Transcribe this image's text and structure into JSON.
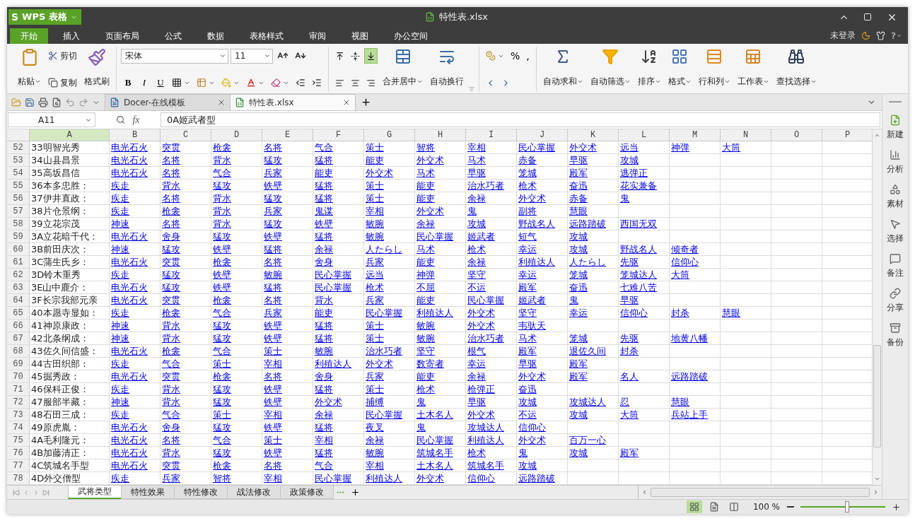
{
  "window": {
    "logo": "S",
    "app_menu": "WPS 表格",
    "title": "特性表.xlsx"
  },
  "menu_tabs": [
    {
      "label": "开始",
      "selected": true
    },
    {
      "label": "插入",
      "selected": false
    },
    {
      "label": "页面布局",
      "selected": false
    },
    {
      "label": "公式",
      "selected": false
    },
    {
      "label": "数据",
      "selected": false
    },
    {
      "label": "表格样式",
      "selected": false
    },
    {
      "label": "审阅",
      "selected": false
    },
    {
      "label": "视图",
      "selected": false
    },
    {
      "label": "办公空间",
      "selected": false
    }
  ],
  "account": {
    "login": "未登录",
    "help": "?"
  },
  "ribbon": {
    "paste": "粘贴",
    "cut": "剪切",
    "copy": "复制",
    "format_painter": "格式刷",
    "font": "宋体",
    "font_size": "11",
    "bold": "B",
    "italic": "I",
    "underline": "U",
    "vertical_align": [
      {
        "kind": "top",
        "selected": false
      },
      {
        "kind": "middle",
        "selected": false
      },
      {
        "kind": "bottom",
        "selected": true
      }
    ],
    "merge": {
      "label": "合并居中",
      "kind": "merge",
      "dropdown": true
    },
    "wrap": {
      "label": "自动换行",
      "kind": "wrap",
      "dropdown": false
    },
    "percent": "%",
    "comma": ",",
    "large_buttons": [
      {
        "label": "自动求和",
        "kind": "sum",
        "dropdown": true
      },
      {
        "label": "自动筛选",
        "kind": "filter",
        "dropdown": true
      },
      {
        "label": "排序",
        "kind": "sort",
        "dropdown": true
      },
      {
        "label": "格式",
        "kind": "format",
        "dropdown": true
      },
      {
        "label": "行和列",
        "kind": "rows",
        "dropdown": true
      },
      {
        "label": "工作表",
        "kind": "sheet",
        "dropdown": true
      },
      {
        "label": "查找选择",
        "kind": "find",
        "dropdown": true
      }
    ]
  },
  "doc_tabs": [
    {
      "label": "Docer-在线模板",
      "kind": "docer",
      "selected": false
    },
    {
      "label": "特性表.xlsx",
      "kind": "sheet",
      "selected": true
    }
  ],
  "formula_bar": {
    "cell_ref": "A11",
    "fx": "fx",
    "formula": "0A姬武者型"
  },
  "columns": [
    {
      "label": "A",
      "selected": true
    },
    {
      "label": "B",
      "selected": false
    },
    {
      "label": "C",
      "selected": false
    },
    {
      "label": "D",
      "selected": false
    },
    {
      "label": "E",
      "selected": false
    },
    {
      "label": "F",
      "selected": false
    },
    {
      "label": "G",
      "selected": false
    },
    {
      "label": "H",
      "selected": false
    },
    {
      "label": "I",
      "selected": false
    },
    {
      "label": "J",
      "selected": false
    },
    {
      "label": "K",
      "selected": false
    },
    {
      "label": "L",
      "selected": false
    },
    {
      "label": "M",
      "selected": false
    },
    {
      "label": "N",
      "selected": false
    },
    {
      "label": "O",
      "selected": false
    },
    {
      "label": "P",
      "selected": false
    }
  ],
  "rows": [
    {
      "number": "52",
      "name": "33明智光秀",
      "traits": [
        "电光石火",
        "突贯",
        "枪衾",
        "名将",
        "气合",
        "策士",
        "智将",
        "宰相",
        "民心掌握",
        "外交术",
        "远当",
        "神弹",
        "大筒"
      ]
    },
    {
      "number": "53",
      "name": "34山县昌景",
      "traits": [
        "电光石火",
        "名将",
        "背水",
        "猛攻",
        "猛将",
        "能吏",
        "外交术",
        "马术",
        "赤备",
        "早驱",
        "攻城"
      ]
    },
    {
      "number": "54",
      "name": "35高坂昌信",
      "traits": [
        "电光石火",
        "名将",
        "气合",
        "兵家",
        "能吏",
        "外交术",
        "马术",
        "早驱",
        "笼城",
        "殿军",
        "逃弹正"
      ]
    },
    {
      "number": "55",
      "name": "36本多忠胜：",
      "traits": [
        "疾走",
        "背水",
        "猛攻",
        "铁壁",
        "猛将",
        "策士",
        "能吏",
        "治水巧者",
        "枪术",
        "奋迅",
        "花实兼备"
      ]
    },
    {
      "number": "56",
      "name": "37伊井直政：",
      "traits": [
        "疾走",
        "名将",
        "背水",
        "猛攻",
        "猛将",
        "策士",
        "能吏",
        "余禄",
        "外交术",
        "赤备",
        "鬼"
      ]
    },
    {
      "number": "57",
      "name": "38片仓景纲：",
      "traits": [
        "疾走",
        "枪衾",
        "背水",
        "兵家",
        "鬼谋",
        "宰相",
        "外交术",
        "鬼",
        "副将",
        "慧眼"
      ]
    },
    {
      "number": "58",
      "name": "39立花宗茂",
      "traits": [
        "神速",
        "名将",
        "背水",
        "猛攻",
        "铁壁",
        "敏腕",
        "余禄",
        "攻城",
        "野战名人",
        "远路踏破",
        "西国无双"
      ]
    },
    {
      "number": "59",
      "name": "3A立花暗千代：",
      "traits": [
        "电光石火",
        "舍身",
        "猛攻",
        "铁壁",
        "猛将",
        "敏腕",
        "民心掌握",
        "姬武者",
        "短气",
        "攻城"
      ]
    },
    {
      "number": "60",
      "name": "3B前田庆次：",
      "traits": [
        "神速",
        "猛攻",
        "铁壁",
        "猛将",
        "余禄",
        "人たらし",
        "马术",
        "枪术",
        "幸运",
        "攻城",
        "野战名人",
        "倾奇者"
      ]
    },
    {
      "number": "61",
      "name": "3C蒲生氏乡：",
      "traits": [
        "电光石火",
        "突贯",
        "枪衾",
        "名将",
        "舍身",
        "兵家",
        "能吏",
        "余禄",
        "利殖达人",
        "人たらし",
        "先驱",
        "信仰心"
      ]
    },
    {
      "number": "62",
      "name": "3D铃木重秀",
      "traits": [
        "疾走",
        "猛攻",
        "铁壁",
        "敏腕",
        "民心掌握",
        "远当",
        "神弹",
        "坚守",
        "幸运",
        "笼城",
        "笼城达人",
        "大筒"
      ]
    },
    {
      "number": "63",
      "name": "3E山中鹿介：",
      "traits": [
        "电光石火",
        "猛攻",
        "铁壁",
        "猛将",
        "民心掌握",
        "枪术",
        "不屈",
        "不运",
        "殿军",
        "奋迅",
        "七难八苦"
      ]
    },
    {
      "number": "64",
      "name": "3F长宗我部元亲",
      "traits": [
        "电光石火",
        "突贯",
        "枪衾",
        "名将",
        "背水",
        "兵家",
        "能吏",
        "民心掌握",
        "姬武者",
        "鬼",
        "早驱"
      ]
    },
    {
      "number": "65",
      "name": "40本愿寺显如：",
      "traits": [
        "疾走",
        "枪衾",
        "气合",
        "兵家",
        "能吏",
        "民心掌握",
        "利殖达人",
        "外交术",
        "坚守",
        "幸运",
        "信仰心",
        "封杀",
        "慧眼"
      ]
    },
    {
      "number": "66",
      "name": "41神原康政：",
      "traits": [
        "神速",
        "背水",
        "猛攻",
        "铁壁",
        "猛将",
        "策士",
        "敏腕",
        "外交术",
        "韦驮天"
      ]
    },
    {
      "number": "67",
      "name": "42北条纲成：",
      "traits": [
        "神速",
        "背水",
        "猛攻",
        "铁壁",
        "猛将",
        "策士",
        "敏腕",
        "治水巧者",
        "马术",
        "笼城",
        "先驱",
        "地黄八幡"
      ]
    },
    {
      "number": "68",
      "name": "43佐久间信盛：",
      "traits": [
        "电光石火",
        "枪衾",
        "气合",
        "策士",
        "敏腕",
        "治水巧者",
        "坚守",
        "根气",
        "殿军",
        "退佐久间",
        "封杀"
      ]
    },
    {
      "number": "69",
      "name": "44古田织部：",
      "traits": [
        "疾走",
        "气合",
        "策士",
        "宰相",
        "利殖达人",
        "外交术",
        "数寄者",
        "幸运",
        "早驱",
        "殿军"
      ]
    },
    {
      "number": "70",
      "name": "45掘秀政：",
      "traits": [
        "电光石火",
        "突贯",
        "枪衾",
        "名将",
        "舍身",
        "兵家",
        "能吏",
        "余禄",
        "外交术",
        "殿军",
        "名人",
        "远路踏破"
      ]
    },
    {
      "number": "71",
      "name": "46保科正俊：",
      "traits": [
        "疾走",
        "背水",
        "猛攻",
        "铁壁",
        "猛将",
        "策士",
        "枪术",
        "枪弹正",
        "奋迅"
      ]
    },
    {
      "number": "72",
      "name": "47服部半藏：",
      "traits": [
        "神速",
        "背水",
        "猛攻",
        "铁壁",
        "外交术",
        "捕缚",
        "鬼",
        "早驱",
        "攻城",
        "攻城达人",
        "忍",
        "慧眼"
      ]
    },
    {
      "number": "73",
      "name": "48石田三成：",
      "traits": [
        "疾走",
        "气合",
        "策士",
        "宰相",
        "余禄",
        "民心掌握",
        "土木名人",
        "外交术",
        "不运",
        "攻城",
        "大筒",
        "兵站上手"
      ]
    },
    {
      "number": "74",
      "name": "49原虎胤：",
      "traits": [
        "电光石火",
        "舍身",
        "猛攻",
        "铁壁",
        "猛将",
        "夜叉",
        "鬼",
        "攻城达人",
        "信仰心"
      ]
    },
    {
      "number": "75",
      "name": "4A毛利隆元：",
      "traits": [
        "电光石火",
        "名将",
        "气合",
        "策士",
        "宰相",
        "余禄",
        "民心掌握",
        "利殖达人",
        "外交术",
        "百万一心"
      ]
    },
    {
      "number": "76",
      "name": "4B加藤清正：",
      "traits": [
        "电光石火",
        "背水",
        "猛攻",
        "铁壁",
        "猛将",
        "敏腕",
        "筑城名手",
        "枪术",
        "鬼",
        "攻城",
        "殿军"
      ]
    },
    {
      "number": "77",
      "name": "4C筑城名手型",
      "traits": [
        "电光石火",
        "突贯",
        "枪衾",
        "名将",
        "气合",
        "宰相",
        "土木名人",
        "筑城名手",
        "攻城"
      ]
    },
    {
      "number": "78",
      "name": "4D外交僧型",
      "traits": [
        "疾走",
        "兵家",
        "智将",
        "宰相",
        "民心掌握",
        "利殖达人",
        "外交术",
        "信仰心",
        "远路踏破"
      ]
    }
  ],
  "sheet_tabs": [
    {
      "label": "武将类型",
      "selected": true
    },
    {
      "label": "特性效果",
      "selected": false
    },
    {
      "label": "特性修改",
      "selected": false
    },
    {
      "label": "战法修改",
      "selected": false
    },
    {
      "label": "政策修改",
      "selected": false
    }
  ],
  "side_panel": [
    {
      "label": "新建",
      "kind": "new"
    },
    {
      "label": "分析",
      "kind": "analyze"
    },
    {
      "label": "素材",
      "kind": "assets"
    },
    {
      "label": "选择",
      "kind": "select"
    },
    {
      "label": "备注",
      "kind": "note"
    },
    {
      "label": "分享",
      "kind": "share"
    },
    {
      "label": "备份",
      "kind": "backup"
    }
  ],
  "status_bar": {
    "views": [
      {
        "kind": "normal",
        "selected": true
      },
      {
        "kind": "page",
        "selected": false
      },
      {
        "kind": "split",
        "selected": false
      }
    ],
    "zoom": "100 %",
    "zoom_slider": {
      "level": 0.55
    }
  }
}
